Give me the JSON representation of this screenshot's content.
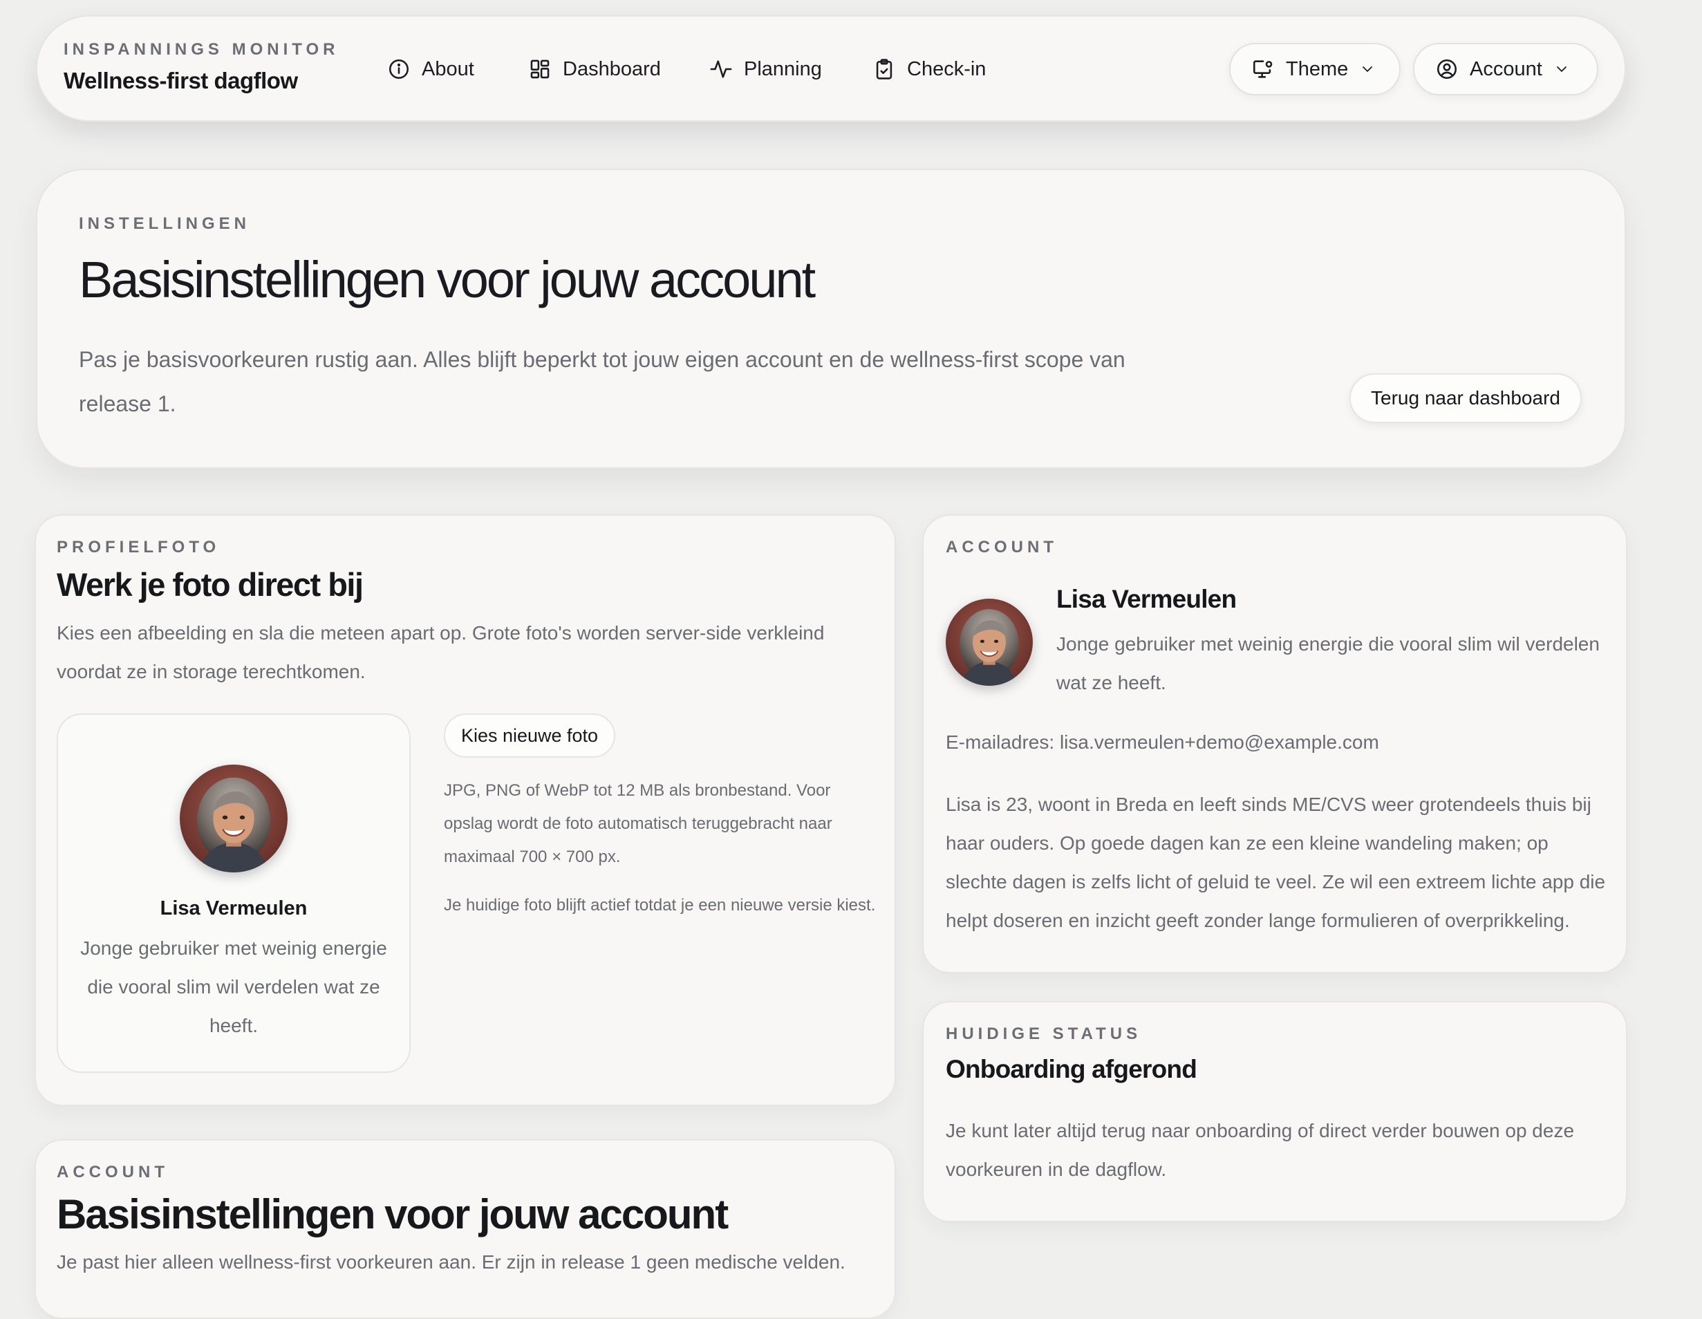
{
  "nav": {
    "eyebrow": "INSPANNINGS MONITOR",
    "brand": "Wellness-first dagflow",
    "items": [
      {
        "label": "About",
        "icon": "info-icon"
      },
      {
        "label": "Dashboard",
        "icon": "grid-icon"
      },
      {
        "label": "Planning",
        "icon": "activity-icon"
      },
      {
        "label": "Check-in",
        "icon": "clipboard-icon"
      }
    ],
    "theme_label": "Theme",
    "account_label": "Account"
  },
  "hero": {
    "eyebrow": "INSTELLINGEN",
    "title": "Basisinstellingen voor jouw account",
    "description": "Pas je basisvoorkeuren rustig aan. Alles blijft beperkt tot jouw eigen account en de wellness-first scope van release 1.",
    "back_button": "Terug naar dashboard"
  },
  "photo_card": {
    "eyebrow": "PROFIELFOTO",
    "title": "Werk je foto direct bij",
    "description": "Kies een afbeelding en sla die meteen apart op. Grote foto's worden server-side verkleind voordat ze in storage terechtkomen.",
    "preview_name": "Lisa Vermeulen",
    "preview_bio": "Jonge gebruiker met weinig energie die vooral slim wil verdelen wat ze heeft.",
    "choose_button": "Kies nieuwe foto",
    "help_text": "JPG, PNG of WebP tot 12 MB als bronbestand. Voor opslag wordt de foto automatisch teruggebracht naar maximaal 700 × 700 px.",
    "current_note": "Je huidige foto blijft actief totdat je een nieuwe versie kiest."
  },
  "account_card": {
    "eyebrow": "ACCOUNT",
    "name": "Lisa Vermeulen",
    "bio": "Jonge gebruiker met weinig energie die vooral slim wil verdelen wat ze heeft.",
    "email": "E-mailadres: lisa.vermeulen+demo@example.com",
    "story": "Lisa is 23, woont in Breda en leeft sinds ME/CVS weer grotendeels thuis bij haar ouders. Op goede dagen kan ze een kleine wandeling maken; op slechte dagen is zelfs licht of geluid te veel. Ze wil een extreem lichte app die helpt doseren en inzicht geeft zonder lange formulieren of overprikkeling."
  },
  "status_card": {
    "eyebrow": "HUIDIGE STATUS",
    "title": "Onboarding afgerond",
    "description": "Je kunt later altijd terug naar onboarding of direct verder bouwen op deze voorkeuren in de dagflow."
  },
  "settings_card": {
    "eyebrow": "ACCOUNT",
    "title": "Basisinstellingen voor jouw account",
    "description": "Je past hier alleen wellness-first voorkeuren aan. Er zijn in release 1 geen medische velden."
  },
  "colors": {
    "background": "#efefee",
    "card": "#f8f7f5",
    "text": "#17181c",
    "muted": "#6a6c73",
    "border": "#e6e5e2"
  }
}
